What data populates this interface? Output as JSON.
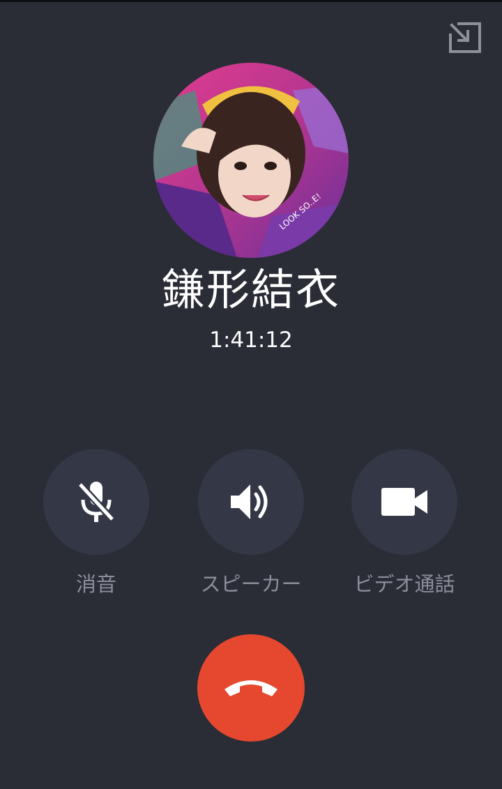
{
  "caller": {
    "name": "鎌形結衣",
    "timer": "1:41:12"
  },
  "controls": [
    {
      "id": "mute",
      "label": "消音",
      "icon": "mic-off-icon"
    },
    {
      "id": "speaker",
      "label": "スピーカー",
      "icon": "speaker-icon"
    },
    {
      "id": "video",
      "label": "ビデオ通話",
      "icon": "video-camera-icon"
    }
  ],
  "end_call": {
    "icon": "hang-up-icon"
  },
  "minimize": {
    "icon": "minimize-arrow-icon"
  },
  "avatar": {
    "icon": "caller-avatar-photo"
  },
  "colors": {
    "background": "#2a2c36",
    "control_bg": "#343745",
    "end_call": "#e5482e",
    "label": "#8c8f9c"
  }
}
